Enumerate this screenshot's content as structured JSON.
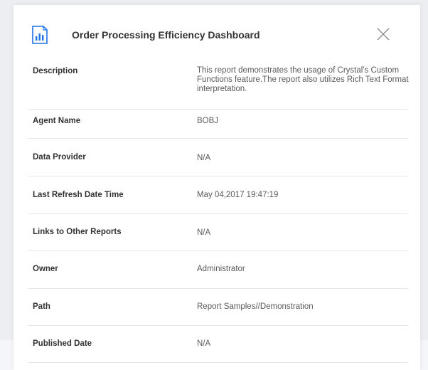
{
  "dialog": {
    "title": "Order Processing Efficiency Dashboard",
    "icon": "report-icon",
    "close_icon": "close-icon",
    "accent": "#1a73e8"
  },
  "properties": [
    {
      "label": "Description",
      "value": "This report demonstrates the usage of Crystal's Custom Functions feature.The report also utilizes Rich Text Format interpretation."
    },
    {
      "label": "Agent Name",
      "value": "BOBJ"
    },
    {
      "label": "Data Provider",
      "value": "N/A"
    },
    {
      "label": "Last Refresh Date Time",
      "value": "May 04,2017 19:47:19"
    },
    {
      "label": "Links to Other Reports",
      "value": "N/A"
    },
    {
      "label": "Owner",
      "value": "Administrator"
    },
    {
      "label": "Path",
      "value": "Report Samples//Demonstration"
    },
    {
      "label": "Published Date",
      "value": "N/A"
    }
  ]
}
